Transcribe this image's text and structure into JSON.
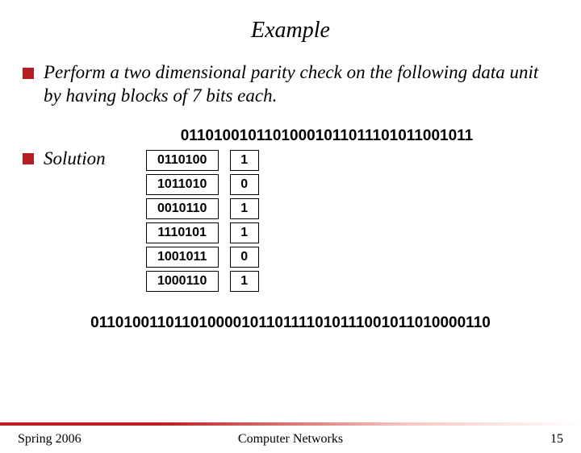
{
  "title": "Example",
  "prompt": "Perform a two dimensional parity check on the following data unit by having blocks of 7 bits each.",
  "bitstring_top": "01101001011010001011011101011001011",
  "solution_label": "Solution",
  "rows": [
    {
      "bits": "0110100",
      "parity": "1"
    },
    {
      "bits": "1011010",
      "parity": "0"
    },
    {
      "bits": "0010110",
      "parity": "1"
    },
    {
      "bits": "1110101",
      "parity": "1"
    },
    {
      "bits": "1001011",
      "parity": "0"
    },
    {
      "bits": "1000110",
      "parity": "1"
    }
  ],
  "bitstring_bottom": "011010011011010000101101111010111001011010000110",
  "footer": {
    "left": "Spring 2006",
    "center": "Computer Networks",
    "page": "15"
  }
}
